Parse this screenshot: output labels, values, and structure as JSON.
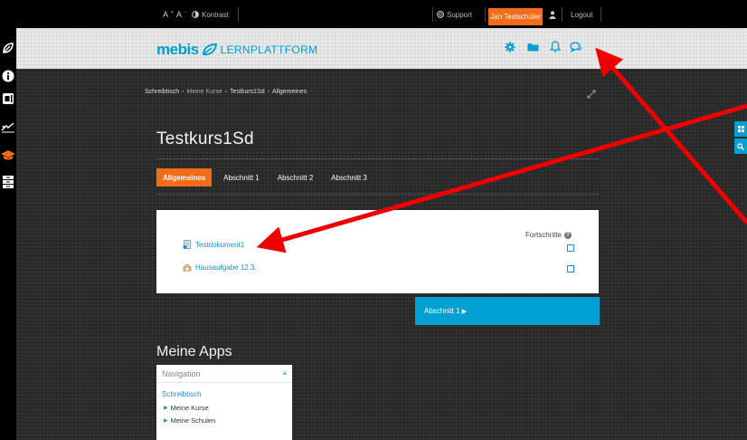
{
  "topbar": {
    "font_size_up": "A",
    "font_size_down": "A",
    "contrast_label": "Kontrast",
    "support_label": "Support",
    "user_name": "Jan Testschüler",
    "logout_label": "Logout"
  },
  "header": {
    "logo_mebis": "mebis",
    "logo_sub": "LERNPLATTFORM"
  },
  "breadcrumb": {
    "items": [
      "Schreibtisch",
      "Meine Kurse",
      "Testkurs1Sd",
      "Allgemeines"
    ],
    "separator": "›"
  },
  "course": {
    "title": "Testkurs1Sd"
  },
  "tabs": [
    {
      "label": "Allgemeines",
      "active": true
    },
    {
      "label": "Abschnitt 1",
      "active": false
    },
    {
      "label": "Abschnitt 2",
      "active": false
    },
    {
      "label": "Abschnitt 3",
      "active": false
    }
  ],
  "card": {
    "progress_label": "Fortschritte",
    "help_glyph": "?",
    "activities": [
      {
        "label": "Testdokument1",
        "icon": "document-icon"
      },
      {
        "label": "Hausaufgabe 12.3.",
        "icon": "assignment-icon"
      }
    ]
  },
  "section_nav": {
    "next_label": "Abschnitt 1",
    "next_glyph": "▶"
  },
  "apps": {
    "title": "Meine Apps",
    "nav_block_title": "Navigation",
    "nav_collapse_glyph": "≡",
    "home_link": "Schreibtisch",
    "sub_items": [
      "Meine Kurse",
      "Meine Schulen"
    ]
  },
  "colors": {
    "accent_orange": "#f26c1a",
    "accent_blue": "#00a0d2",
    "annotation_red": "#ee0000"
  }
}
